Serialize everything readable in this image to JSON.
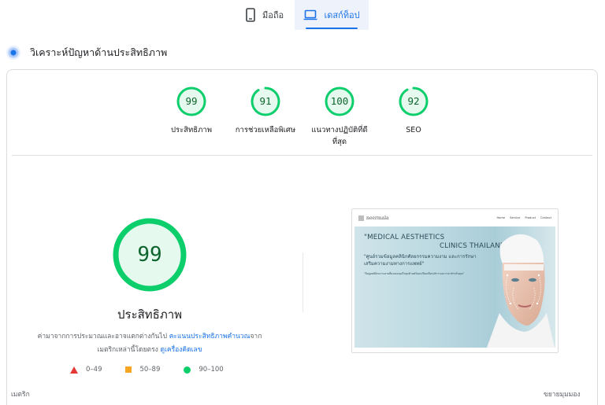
{
  "tabs": {
    "mobile": {
      "label": "มือถือ"
    },
    "desktop": {
      "label": "เดสก์ท็อป"
    }
  },
  "section": {
    "title": "วิเคราะห์ปัญหาด้านประสิทธิภาพ"
  },
  "scores": [
    {
      "value": "99",
      "fraction": 0.99,
      "label": "ประสิทธิภาพ",
      "label2": ""
    },
    {
      "value": "91",
      "fraction": 0.91,
      "label": "การช่วยเหลือพิเศษ",
      "label2": ""
    },
    {
      "value": "100",
      "fraction": 1.0,
      "label": "แนวทางปฏิบัติที่ดี",
      "label2": "ที่สุด"
    },
    {
      "value": "92",
      "fraction": 0.92,
      "label": "SEO",
      "label2": ""
    }
  ],
  "performance": {
    "value": "99",
    "fraction": 0.99,
    "title": "ประสิทธิภาพ",
    "desc_part1": "ค่ามาจากการประมาณและอาจแตกต่างกันไป ",
    "desc_link1": "คะแนนประสิทธิภาพคำนวณ",
    "desc_part2": "จาก",
    "desc_part3": "เมตริกเหล่านี้โดยตรง ",
    "desc_link2": "ดูเครื่องคิดเลข"
  },
  "legend": {
    "bad": "0–49",
    "average": "50–89",
    "good": "90–100"
  },
  "thumbnail": {
    "logo": "neermala",
    "menu": [
      "Home",
      "Service",
      "Product",
      "Contact"
    ],
    "headline_1": "\"MEDICAL AESTHETICS",
    "headline_2": "CLINICS THAILAND\"",
    "subtitle": "\"ศูนย์รวมข้อมูลคลินิกศัลยกรรมความงาม และการรักษาเสริมความงามทางการแพทย์\"",
    "small_text": "\"ข้อมูลคลินิกความงามที่ครอบคลุมในทุกด้านพร้อมเปรียบเทียบบริการและราคาสำหรับคุณ\""
  },
  "footer": {
    "metrics_label": "เมตริก",
    "expand_label": "ขยายมุมมอง"
  },
  "colors": {
    "good": "#0cce6b",
    "good_text": "#0d652d",
    "good_bg": "#e6f9ef",
    "accent": "#1a73e8"
  }
}
